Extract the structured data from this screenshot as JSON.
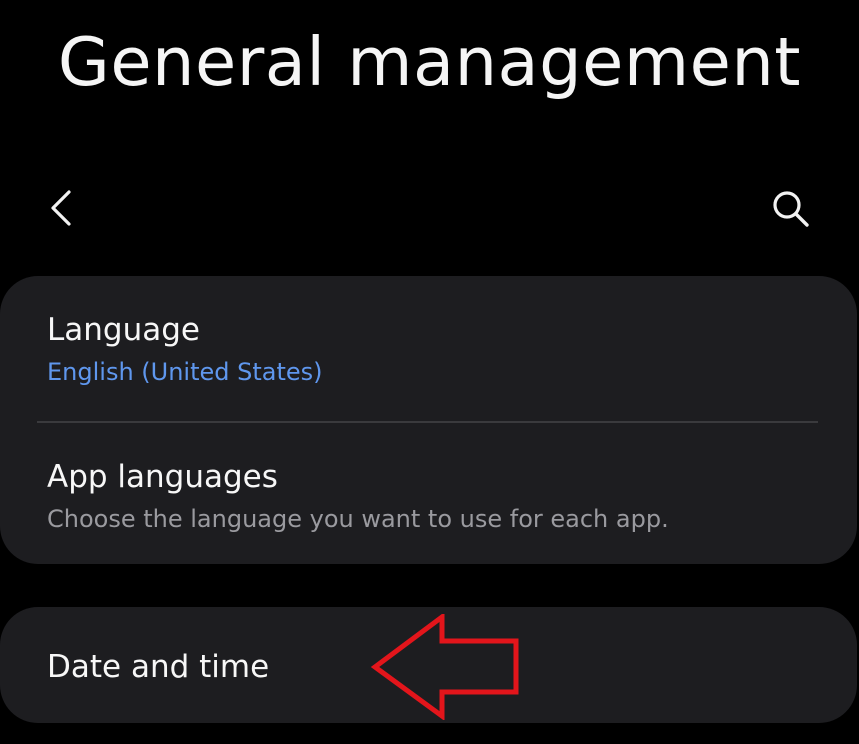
{
  "header": {
    "title": "General management",
    "back_icon": "chevron-left-icon",
    "search_icon": "search-icon"
  },
  "settings": {
    "language": {
      "label": "Language",
      "value": "English (United States)"
    },
    "app_languages": {
      "label": "App languages",
      "description": "Choose the language you want to use for each app."
    },
    "date_and_time": {
      "label": "Date and time"
    }
  },
  "annotation": {
    "icon": "left-arrow-annotation",
    "color": "#e3151b"
  },
  "colors": {
    "background": "#000000",
    "card": "#1d1d20",
    "accent_blue": "#5f97ee",
    "secondary_text": "#9a9a9f"
  }
}
